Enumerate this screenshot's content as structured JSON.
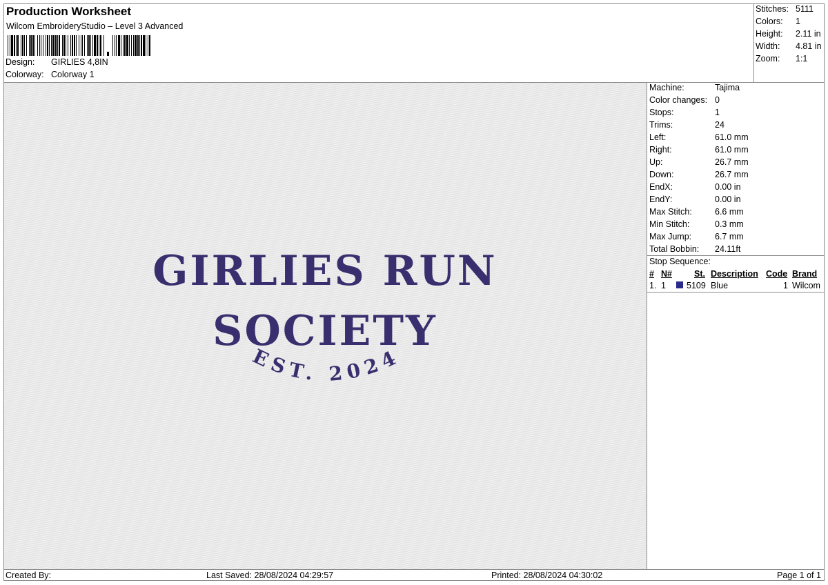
{
  "header": {
    "title": "Production Worksheet",
    "subtitle": "Wilcom EmbroideryStudio – Level 3 Advanced",
    "design_label": "Design:",
    "design_value": "GIRLIES 4,8IN",
    "colorway_label": "Colorway:",
    "colorway_value": "Colorway 1"
  },
  "stats": [
    {
      "label": "Stitches:",
      "value": "5111"
    },
    {
      "label": "Colors:",
      "value": "1"
    },
    {
      "label": "Height:",
      "value": "2.11 in"
    },
    {
      "label": "Width:",
      "value": "4.81 in"
    },
    {
      "label": "Zoom:",
      "value": "1:1"
    }
  ],
  "design_preview": {
    "line1": "GIRLIES RUN",
    "line2": "SOCIETY",
    "line3": "EST. 2024",
    "thread_color": "#3a2f6e"
  },
  "machine_info": [
    {
      "label": "Machine:",
      "value": "Tajima"
    },
    {
      "label": "Color changes:",
      "value": "0"
    },
    {
      "label": "Stops:",
      "value": "1"
    },
    {
      "label": "Trims:",
      "value": "24"
    },
    {
      "label": "Left:",
      "value": "61.0 mm"
    },
    {
      "label": "Right:",
      "value": "61.0 mm"
    },
    {
      "label": "Up:",
      "value": "26.7 mm"
    },
    {
      "label": "Down:",
      "value": "26.7 mm"
    },
    {
      "label": "EndX:",
      "value": "0.00 in"
    },
    {
      "label": "EndY:",
      "value": "0.00 in"
    },
    {
      "label": "Max Stitch:",
      "value": "6.6 mm"
    },
    {
      "label": "Min Stitch:",
      "value": "0.3 mm"
    },
    {
      "label": "Max Jump:",
      "value": "6.7 mm"
    },
    {
      "label": "Total Bobbin:",
      "value": "24.11ft"
    }
  ],
  "stop_sequence": {
    "title": "Stop Sequence:",
    "headers": {
      "num": "#",
      "n": "N#",
      "st": "St.",
      "description": "Description",
      "code": "Code",
      "brand": "Brand"
    },
    "rows": [
      {
        "num": "1.",
        "n": "1",
        "st": "5109",
        "description": "Blue",
        "code": "1",
        "brand": "Wilcom",
        "swatch": "#2a2a8a"
      }
    ]
  },
  "footer": {
    "created_by": "Created By:",
    "last_saved": "Last Saved: 28/08/2024 04:29:57",
    "printed": "Printed: 28/08/2024 04:30:02",
    "page": "Page 1 of 1"
  }
}
